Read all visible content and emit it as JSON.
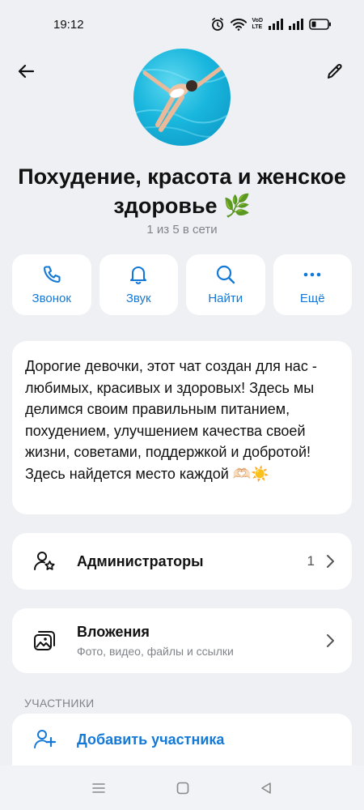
{
  "status_bar": {
    "time": "19:12",
    "vo_lte_line1": "VoD",
    "vo_lte_line2": "LTE"
  },
  "header": {
    "title": "Похудение, красота и женское здоровье 🌿",
    "subtitle": "1 из 5 в сети"
  },
  "actions": [
    {
      "label": "Звонок",
      "icon": "phone-icon"
    },
    {
      "label": "Звук",
      "icon": "bell-icon"
    },
    {
      "label": "Найти",
      "icon": "search-icon"
    },
    {
      "label": "Ещё",
      "icon": "more-icon"
    }
  ],
  "about": {
    "text": "Дорогие девочки, этот чат создан для нас - любимых, красивых и здоровых! Здесь мы делимся своим правильным питанием, похудением, улучшением качества своей жизни, советами, поддержкой и добротой! Здесь найдется место каждой 🫶🏻☀️"
  },
  "admins": {
    "label": "Администраторы",
    "count": "1"
  },
  "attachments": {
    "label": "Вложения",
    "sublabel": "Фото, видео, файлы и ссылки"
  },
  "members": {
    "section_label": "УЧАСТНИКИ",
    "add_label": "Добавить участника"
  },
  "colors": {
    "accent": "#1479d6",
    "background": "#eff0f4",
    "card": "#ffffff",
    "muted": "#808389"
  }
}
